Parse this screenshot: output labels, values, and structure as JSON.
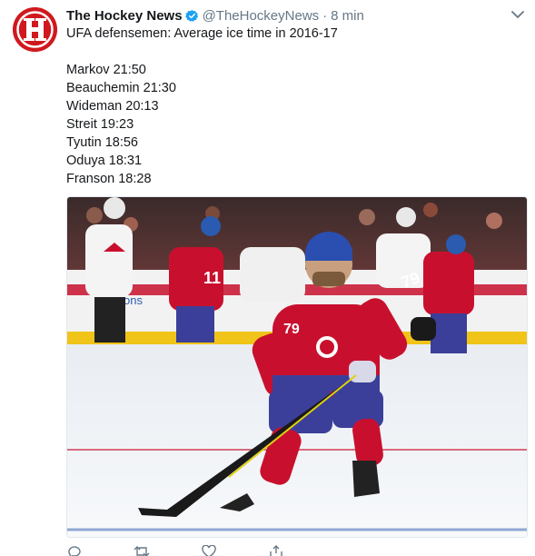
{
  "tweet": {
    "display_name": "The Hockey News",
    "handle": "@TheHockeyNews",
    "separator": "·",
    "time": "8 min",
    "lines": [
      "UFA defensemen: Average ice time in 2016-17",
      "",
      "Markov 21:50",
      "Beauchemin 21:30",
      "Wideman 20:13",
      "Streit 19:23",
      "Tyutin 18:56",
      "Oduya 18:31",
      "Franson 18:28"
    ],
    "media_jersey_numbers": [
      "79",
      "79",
      "11"
    ],
    "media_board_text": "ons"
  },
  "icons": {
    "avatar": "hockey-news-logo",
    "verified": "verified-badge-icon",
    "menu": "chevron-down-icon",
    "actions": [
      "reply-icon",
      "retweet-icon",
      "like-icon",
      "share-icon"
    ]
  },
  "colors": {
    "brand_red": "#d0191e",
    "verified_blue": "#1da1f2",
    "secondary_text": "#657786",
    "canadiens_red": "#c8102e",
    "canadiens_blue": "#3b3f9a"
  }
}
